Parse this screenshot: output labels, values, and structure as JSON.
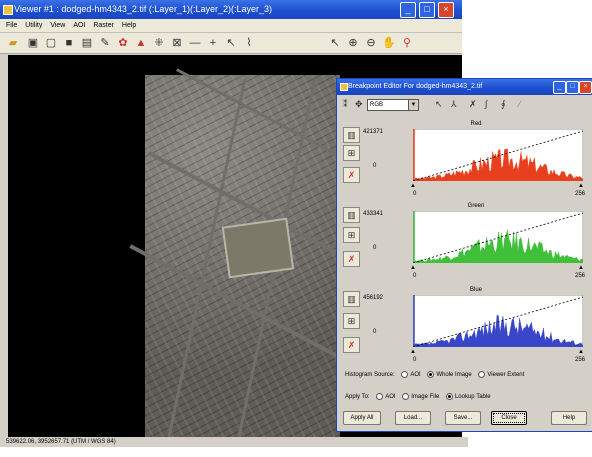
{
  "viewer": {
    "title": "Viewer #1 : dodged-hm4343_2.tif (:Layer_1)(:Layer_2)(:Layer_3)",
    "menu": [
      "File",
      "Utility",
      "View",
      "AOI",
      "Raster",
      "Help"
    ],
    "status": "539622.06, 3952657.71  (UTM / WGS 84)"
  },
  "editor": {
    "title": "Breakpoint Editor For dodged-hm4343_2.tif",
    "band_select": "RGB",
    "panels": [
      {
        "name": "Red",
        "max": "421371",
        "zero": "0",
        "x_min": "0",
        "x_max": "256",
        "color": "#e8401e"
      },
      {
        "name": "Green",
        "max": "433341",
        "zero": "0",
        "x_min": "0",
        "x_max": "256",
        "color": "#3fbf3a"
      },
      {
        "name": "Blue",
        "max": "456192",
        "zero": "0",
        "x_min": "0",
        "x_max": "256",
        "color": "#3a46c8"
      }
    ],
    "histogram_source": {
      "label": "Histogram Source:",
      "options": [
        "AOI",
        "Whole Image",
        "Viewer Extent"
      ],
      "selected": "Whole Image"
    },
    "apply_to": {
      "label": "Apply To:",
      "options": [
        "AOI",
        "Image File",
        "Lookup Table"
      ],
      "selected": "Lookup Table"
    },
    "buttons": {
      "apply_all": "Apply All",
      "load": "Load...",
      "save": "Save...",
      "close": "Close",
      "help": "Help"
    }
  }
}
